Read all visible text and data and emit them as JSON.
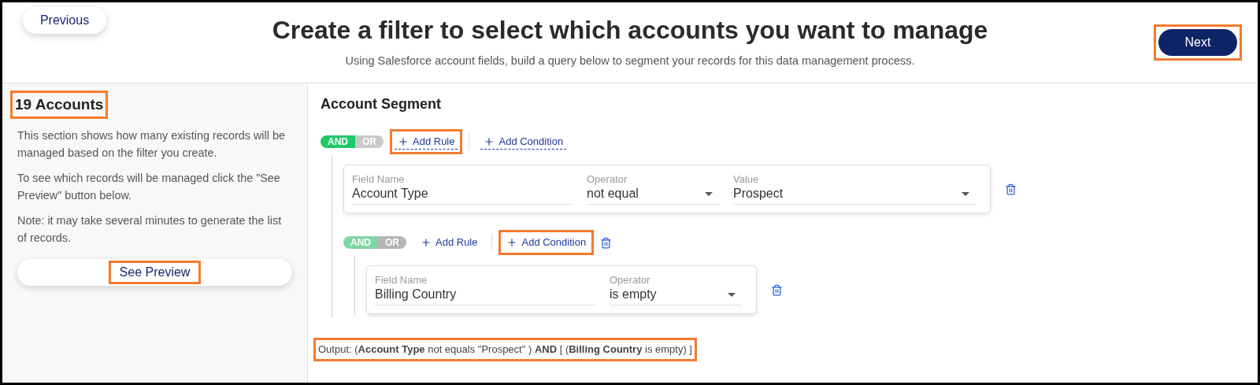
{
  "header": {
    "back_button": {
      "label": "Previous",
      "highlighted": false
    },
    "title": "Create a filter to select which accounts you want to manage",
    "subtitle": "Using Salesforce account fields, build a query below to segment your records for this data management process.",
    "next_button": {
      "label": "Next",
      "highlighted": true
    }
  },
  "sidebar": {
    "count": {
      "text": "19 Accounts",
      "highlighted": true
    },
    "paragraphs": [
      "This section shows how many existing records will be managed based on the filter you create.",
      "To see which records will be managed click the \"See Preview\" button below.",
      "Note: it may take several minutes to generate the list of records."
    ],
    "preview_button": {
      "label": "See Preview",
      "highlighted": true
    }
  },
  "segment": {
    "title": "Account Segment",
    "group": {
      "dimmed": false,
      "deletable": false,
      "conjunction": [
        {
          "label": "AND",
          "selected": true
        },
        {
          "label": "OR",
          "selected": false
        }
      ],
      "actions": [
        {
          "label": "Add Rule",
          "underlined": true,
          "highlighted": true
        },
        {
          "label": "Add Condition",
          "underlined": true,
          "highlighted": false
        }
      ],
      "rules": [
        {
          "fields": [
            {
              "kind": "name",
              "label": "Field Name",
              "value": "Account Type",
              "dropdown": false
            },
            {
              "kind": "operator",
              "label": "Operator",
              "value": "not equal",
              "dropdown": true
            },
            {
              "kind": "value",
              "label": "Value",
              "value": "Prospect",
              "dropdown": true
            }
          ]
        }
      ],
      "children": [
        {
          "dimmed": true,
          "deletable": true,
          "conjunction": [
            {
              "label": "AND",
              "selected": true
            },
            {
              "label": "OR",
              "selected": false
            }
          ],
          "actions": [
            {
              "label": "Add Rule",
              "underlined": false,
              "highlighted": false
            },
            {
              "label": "Add Condition",
              "underlined": false,
              "highlighted": true
            }
          ],
          "rules": [
            {
              "fields": [
                {
                  "kind": "name",
                  "label": "Field Name",
                  "value": "Billing Country",
                  "dropdown": false
                },
                {
                  "kind": "operator",
                  "label": "Operator",
                  "value": "is empty",
                  "dropdown": true
                }
              ]
            }
          ]
        }
      ]
    },
    "output": {
      "text": "Output: (**Account Type** not equals \"Prospect\" ) **AND** [ (**Billing Country** is empty) ]",
      "highlighted": true
    }
  }
}
